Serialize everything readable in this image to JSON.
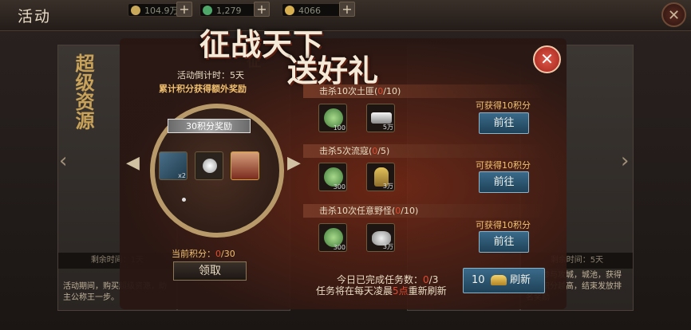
{
  "header": {
    "title": "活动",
    "resources": [
      {
        "icon": "coin-icon",
        "value": "104.9万",
        "color": "#c9a85a"
      },
      {
        "icon": "jade-icon",
        "value": "1,279",
        "color": "#4fa86a"
      },
      {
        "icon": "grain-icon",
        "value": "4066",
        "color": "#d8b050"
      }
    ],
    "plus": "+",
    "close": "✕"
  },
  "background": {
    "left_card_title": "超级资源",
    "left_card_strip": "剩余时间：1天",
    "left_card_desc": "活动期间，购买超级资源，助主公称王一步。",
    "mid_card_title": "征",
    "right_card_strip": "剩余时间：5天",
    "right_card_desc": "军团参与攻城，城池，获得越高积分越高，结束发放排名奖励"
  },
  "popup": {
    "title_line1": "征战天下",
    "title_line2": "送好礼",
    "close": "✕",
    "countdown": "活动倒计时：5天",
    "subtitle": "累计积分获得额外奖励",
    "reward_header": "30积分奖励",
    "reward_slots": [
      "armor-icon",
      "pearl-icon",
      "hero-portrait-icon"
    ],
    "slot_counts": [
      "x2",
      "",
      ""
    ],
    "left_arrow": "◀",
    "right_arrow": "▶",
    "points_label": "当前积分：",
    "points_current": "0",
    "points_total": "/30",
    "claim": "领取",
    "tasks": [
      {
        "name": "击杀10次土匪",
        "progress_open": "(",
        "progress_cur": "0",
        "progress_total": "/10)",
        "rewards": [
          {
            "icon": "jade-icon",
            "count": "100"
          },
          {
            "icon": "silver-icon",
            "count": "5万"
          }
        ],
        "gain": "可获得10积分",
        "go": "前往"
      },
      {
        "name": "击杀5次流寇",
        "progress_open": "(",
        "progress_cur": "0",
        "progress_total": "/5)",
        "rewards": [
          {
            "icon": "jade-icon",
            "count": "300"
          },
          {
            "icon": "grain-icon",
            "count": "3万"
          }
        ],
        "gain": "可获得10积分",
        "go": "前往"
      },
      {
        "name": "击杀10次任意野怪",
        "progress_open": "(",
        "progress_cur": "0",
        "progress_total": "/10)",
        "rewards": [
          {
            "icon": "jade-icon",
            "count": "300"
          },
          {
            "icon": "stone-icon",
            "count": "3万"
          }
        ],
        "gain": "可获得10积分",
        "go": "前往"
      }
    ],
    "done_label": "今日已完成任务数：",
    "done_cur": "0",
    "done_total": "/3",
    "refresh_note_a": "任务将在每天凌晨",
    "refresh_note_b": "5点",
    "refresh_note_c": "重新刷新",
    "refresh_cost": "10",
    "refresh_label": "刷新"
  }
}
